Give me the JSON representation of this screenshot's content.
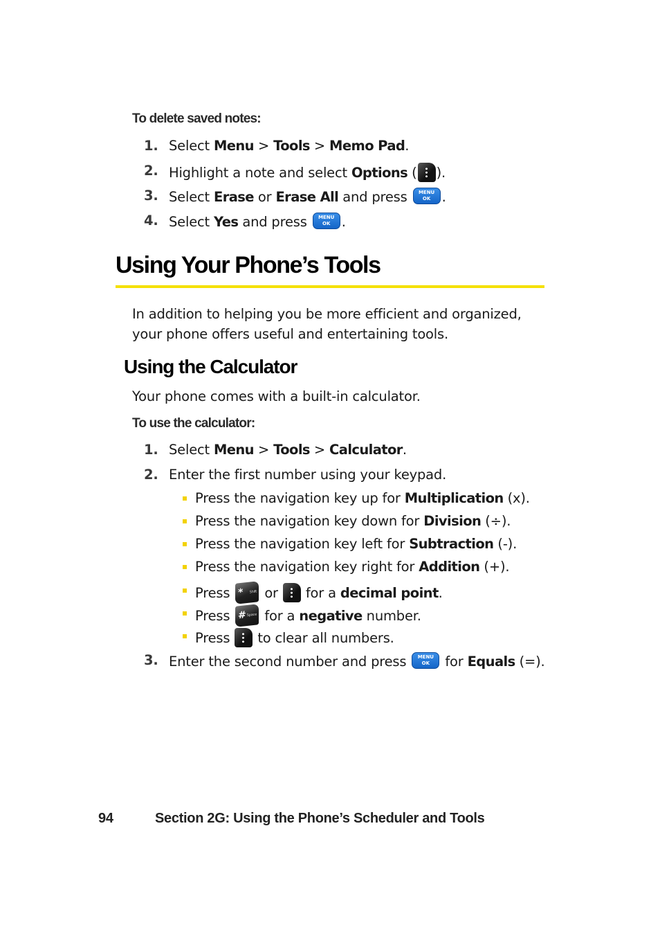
{
  "delete_notes": {
    "heading": "To delete saved notes:",
    "steps": [
      {
        "num": "1.",
        "pre": "Select ",
        "b1": "Menu",
        "sep1": " > ",
        "b2": "Tools",
        "sep2": " > ",
        "b3": "Memo Pad",
        "post": "."
      },
      {
        "num": "2.",
        "pre": "Highlight a note and select ",
        "b1": "Options",
        "open": " (",
        "icon": "options-softkey-icon",
        "close": ")."
      },
      {
        "num": "3.",
        "pre": "Select ",
        "b1": "Erase",
        "mid": " or ",
        "b2": "Erase All",
        "post": " and press ",
        "icon": "menu-ok-key-icon",
        "end": "."
      },
      {
        "num": "4.",
        "pre": "Select ",
        "b1": "Yes",
        "post": " and press ",
        "icon": "menu-ok-key-icon",
        "end": "."
      }
    ]
  },
  "section": {
    "title": "Using Your Phone’s Tools",
    "accent_color": "#f5e000",
    "intro_line1": "In addition to helping you be more efficient and organized,",
    "intro_line2": "your phone offers useful and entertaining tools."
  },
  "calculator": {
    "title": "Using the Calculator",
    "intro": "Your phone comes with a built-in calculator.",
    "proc_heading": "To use the calculator:",
    "step1": {
      "num": "1.",
      "pre": "Select ",
      "b1": "Menu",
      "sep1": " > ",
      "b2": "Tools",
      "sep2": " > ",
      "b3": "Calculator",
      "post": "."
    },
    "step2": {
      "num": "2.",
      "text": "Enter the first number using your keypad."
    },
    "bullets": [
      {
        "pre": "Press the navigation key up for ",
        "b": "Multiplication",
        "post": " (x)."
      },
      {
        "pre": "Press the navigation key down for ",
        "b": "Division",
        "post": " (÷)."
      },
      {
        "pre": "Press the navigation key left for ",
        "b": "Subtraction",
        "post": " (-)."
      },
      {
        "pre": "Press the navigation key right for ",
        "b": "Addition",
        "post": " (+)."
      },
      {
        "pre": "Press ",
        "icon1": "star-shift-key-icon",
        "mid": " or ",
        "icon2": "right-softkey-icon",
        "post": " for a ",
        "b": "decimal point",
        "end": "."
      },
      {
        "pre": "Press ",
        "icon1": "pound-space-key-icon",
        "post": " for a ",
        "b": "negative",
        "end": " number."
      },
      {
        "pre": "Press ",
        "icon1": "softkey-icon",
        "post": " to clear all numbers."
      }
    ],
    "step3": {
      "num": "3.",
      "pre": "Enter the second number and press ",
      "icon": "menu-ok-key-icon",
      "mid": " for ",
      "b": "Equals",
      "post": " (=)."
    }
  },
  "keys": {
    "menu_ok_line1": "MENU",
    "menu_ok_line2": "OK",
    "star_glyph": "*",
    "star_sub": "Shift",
    "pound_glyph": "#",
    "pound_sub": "Space"
  },
  "footer": {
    "page_number": "94",
    "section_title": "Section 2G: Using the Phone’s Scheduler and Tools"
  }
}
